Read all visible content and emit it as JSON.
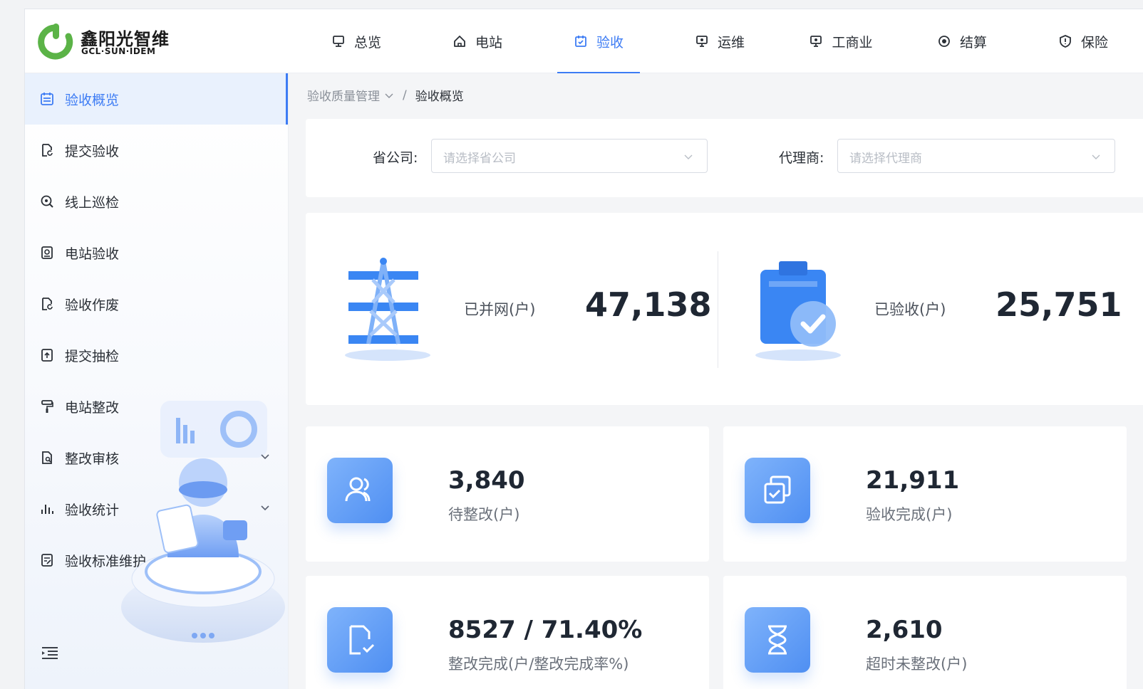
{
  "brand": {
    "name_cn": "鑫阳光智维",
    "name_en": "GCL·SUN·IDEM",
    "accent": "#3d7cf4",
    "logo_green": "#5bb347"
  },
  "topnav": [
    {
      "label": "总览",
      "icon": "monitor-icon"
    },
    {
      "label": "电站",
      "icon": "home-icon"
    },
    {
      "label": "验收",
      "icon": "calendar-check-icon",
      "active": true
    },
    {
      "label": "运维",
      "icon": "presentation-icon"
    },
    {
      "label": "工商业",
      "icon": "presentation-icon"
    },
    {
      "label": "结算",
      "icon": "coin-icon"
    },
    {
      "label": "保险",
      "icon": "shield-icon"
    }
  ],
  "sidebar": {
    "items": [
      {
        "label": "验收概览",
        "icon": "calendar-icon",
        "active": true
      },
      {
        "label": "提交验收",
        "icon": "file-refresh-icon"
      },
      {
        "label": "线上巡检",
        "icon": "zoom-search-icon"
      },
      {
        "label": "电站验收",
        "icon": "file-view-icon"
      },
      {
        "label": "验收作废",
        "icon": "file-refresh-icon"
      },
      {
        "label": "提交抽检",
        "icon": "file-upload-icon"
      },
      {
        "label": "电站整改",
        "icon": "paint-roller-icon"
      },
      {
        "label": "整改审核",
        "icon": "file-search-icon",
        "expandable": true
      },
      {
        "label": "验收统计",
        "icon": "bar-chart-icon",
        "expandable": true
      },
      {
        "label": "验收标准维护",
        "icon": "file-edit-icon"
      }
    ],
    "collapse_icon": "menu-fold-icon"
  },
  "breadcrumb": {
    "parent": "验收质量管理",
    "separator": "/",
    "current": "验收概览"
  },
  "filters": {
    "province": {
      "label": "省公司:",
      "placeholder": "请选择省公司"
    },
    "agent": {
      "label": "代理商:",
      "placeholder": "请选择代理商"
    }
  },
  "summary": {
    "grid": {
      "label": "已并网(户)",
      "value": "47,138",
      "icon": "power-tower-icon"
    },
    "accepted": {
      "label": "已验收(户)",
      "value": "25,751",
      "icon": "clipboard-check-icon"
    }
  },
  "cards": [
    {
      "value": "3,840",
      "label": "待整改(户)",
      "icon": "users-icon"
    },
    {
      "value": "21,911",
      "label": "验收完成(户)",
      "icon": "copy-check-icon"
    },
    {
      "value": "8527 / 71.40%",
      "label": "整改完成(户/整改完成率%)",
      "icon": "file-refresh-icon"
    },
    {
      "value": "2,610",
      "label": "超时未整改(户)",
      "icon": "hourglass-icon"
    }
  ]
}
